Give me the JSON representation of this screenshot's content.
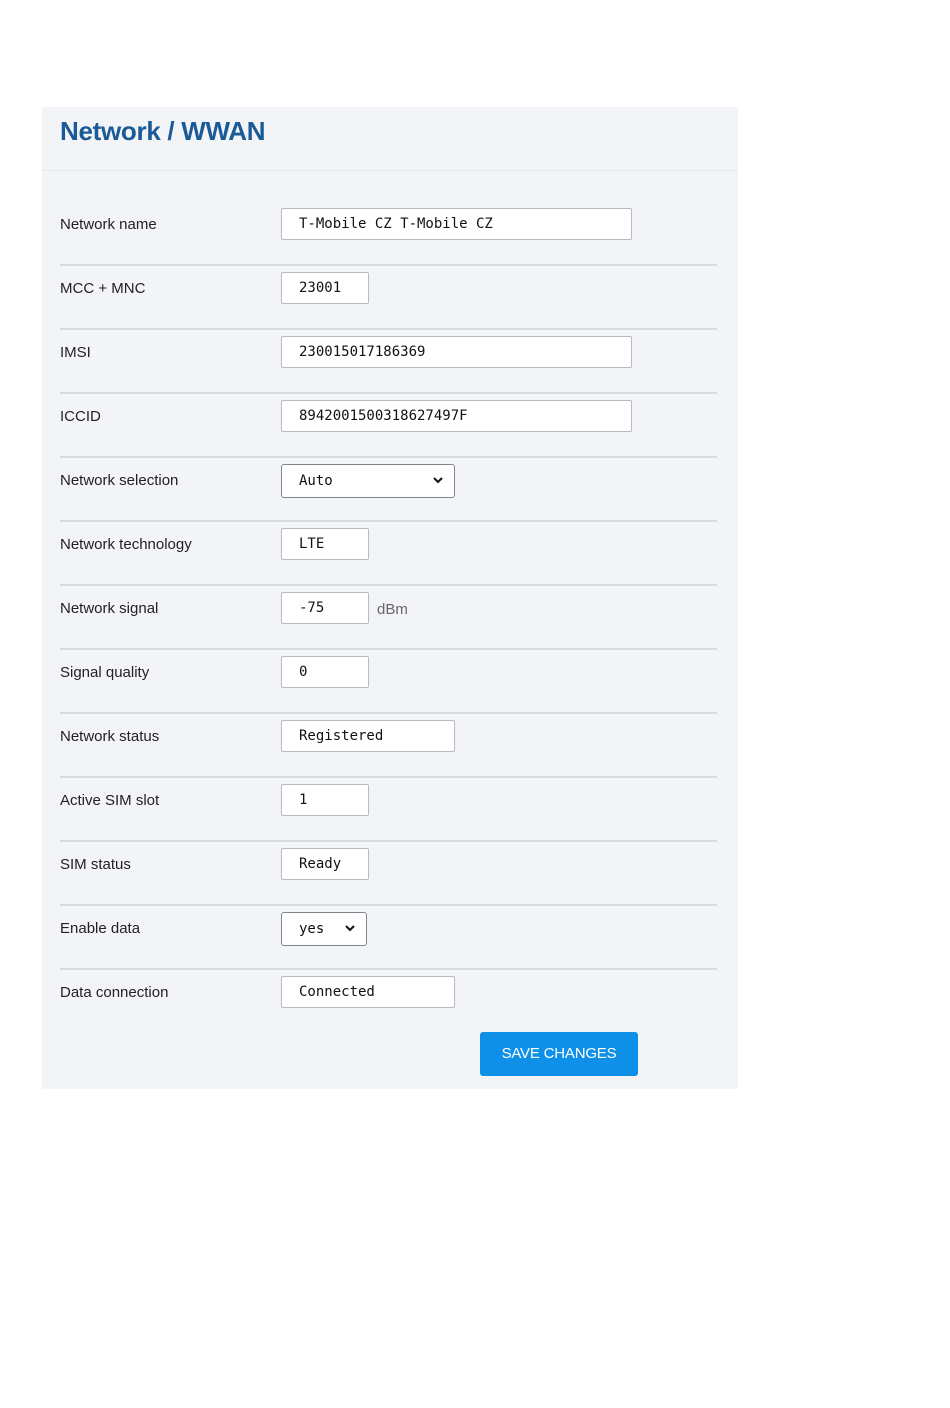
{
  "header": {
    "title": "Network / WWAN"
  },
  "fields": {
    "network_name": {
      "label": "Network name",
      "value": "T-Mobile CZ T-Mobile CZ"
    },
    "mcc_mnc": {
      "label": "MCC + MNC",
      "value": "23001"
    },
    "imsi": {
      "label": "IMSI",
      "value": "230015017186369"
    },
    "iccid": {
      "label": "ICCID",
      "value": "8942001500318627497F"
    },
    "network_selection": {
      "label": "Network selection",
      "value": "Auto"
    },
    "network_technology": {
      "label": "Network technology",
      "value": "LTE"
    },
    "network_signal": {
      "label": "Network signal",
      "value": "-75",
      "unit": "dBm"
    },
    "signal_quality": {
      "label": "Signal quality",
      "value": "0"
    },
    "network_status": {
      "label": "Network status",
      "value": "Registered"
    },
    "active_sim_slot": {
      "label": "Active SIM slot",
      "value": "1"
    },
    "sim_status": {
      "label": "SIM status",
      "value": "Ready"
    },
    "enable_data": {
      "label": "Enable data",
      "value": "yes"
    },
    "data_connection": {
      "label": "Data connection",
      "value": "Connected"
    }
  },
  "actions": {
    "save_label": "SAVE CHANGES"
  },
  "icons": {
    "select_arrow": "chevron-down-icon"
  },
  "colors": {
    "title": "#1a5a96",
    "button": "#0e90e8",
    "panel_background": "#f2f4f7"
  }
}
